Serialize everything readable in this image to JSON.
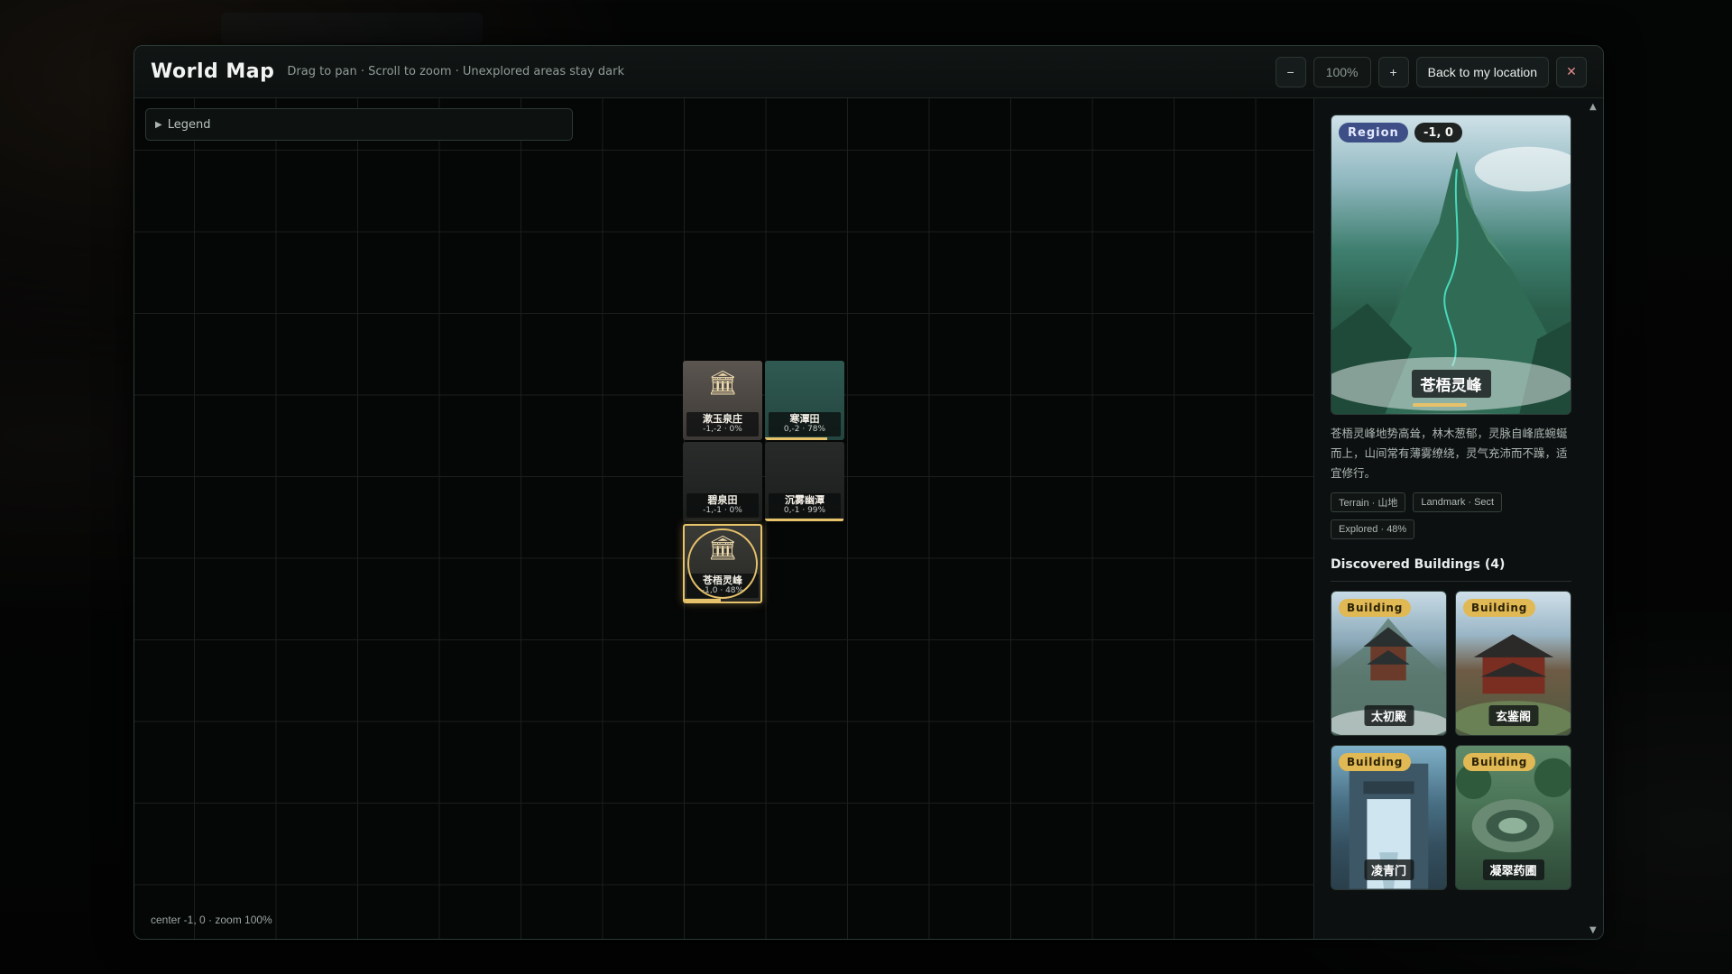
{
  "header": {
    "title": "World Map",
    "subtitle": "Drag to pan · Scroll to zoom · Unexplored areas stay dark",
    "zoom_out": "−",
    "zoom_level": "100%",
    "zoom_in": "+",
    "back_label": "Back to my location",
    "close": "✕"
  },
  "map": {
    "legend_label": "Legend",
    "legend_caret": "▶",
    "status": "center -1, 0 · zoom 100%",
    "tiles": [
      {
        "name": "漱玉泉庄",
        "coord": "-1,-2 · 0%",
        "explored": 0.0,
        "icon": "sect-hall-icon"
      },
      {
        "name": "寒潭田",
        "coord": "0,-2 · 78%",
        "explored": 0.78,
        "icon": ""
      },
      {
        "name": "碧泉田",
        "coord": "-1,-1 · 0%",
        "explored": 0.0,
        "icon": ""
      },
      {
        "name": "沉雾幽潭",
        "coord": "0,-1 · 99%",
        "explored": 0.99,
        "icon": ""
      },
      {
        "name": "苍梧灵峰",
        "coord": "-1,0 · 48%",
        "explored": 0.48,
        "icon": "sect-hall-icon"
      }
    ],
    "icon_glyph": "🏛"
  },
  "panel": {
    "region_badge": "Region",
    "region_coord": "-1, 0",
    "region_name": "苍梧灵峰",
    "region_explored": 0.48,
    "description": "苍梧灵峰地势高耸，林木葱郁，灵脉自峰底蜿蜒而上，山间常有薄雾缭绕，灵气充沛而不躁，适宜修行。",
    "tags": [
      "Terrain · 山地",
      "Landmark · Sect",
      "Explored · 48%"
    ],
    "buildings_title": "Discovered Buildings (4)",
    "buildings": [
      {
        "badge": "Building",
        "name": "太初殿"
      },
      {
        "badge": "Building",
        "name": "玄鉴阁"
      },
      {
        "badge": "Building",
        "name": "凌青门"
      },
      {
        "badge": "Building",
        "name": "凝翠药圃"
      }
    ],
    "scroll_up": "▲",
    "scroll_down": "▼"
  },
  "colors": {
    "accent_gold": "#e6c26a",
    "region_badge": "#3d4f86",
    "building_badge": "#e0b954"
  }
}
